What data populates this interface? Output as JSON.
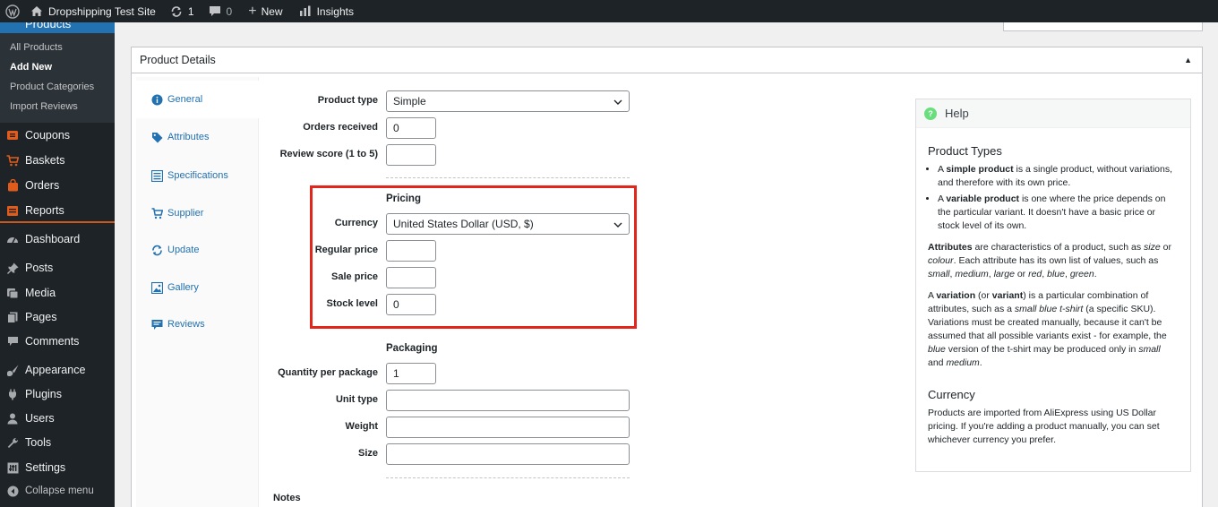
{
  "adminbar": {
    "site_name": "Dropshipping Test Site",
    "updates_count": "1",
    "comments_count": "0",
    "new_label": "New",
    "insights_label": "Insights"
  },
  "sidebar": {
    "active_section": "Products",
    "submenu": [
      "All Products",
      "Add New",
      "Product Categories",
      "Import Reviews"
    ],
    "items": [
      "Coupons",
      "Baskets",
      "Orders",
      "Reports",
      "Dashboard",
      "Posts",
      "Media",
      "Pages",
      "Comments",
      "Appearance",
      "Plugins",
      "Users",
      "Tools",
      "Settings",
      "Collapse menu"
    ]
  },
  "panel": {
    "title": "Product Details"
  },
  "tabs": [
    "General",
    "Attributes",
    "Specifications",
    "Supplier",
    "Update",
    "Gallery",
    "Reviews"
  ],
  "form": {
    "product_type_label": "Product type",
    "product_type_value": "Simple",
    "orders_received_label": "Orders received",
    "orders_received_value": "0",
    "review_score_label": "Review score (1 to 5)",
    "review_score_value": "",
    "pricing_title": "Pricing",
    "currency_label": "Currency",
    "currency_value": "United States Dollar (USD, $)",
    "regular_price_label": "Regular price",
    "regular_price_value": "",
    "sale_price_label": "Sale price",
    "sale_price_value": "",
    "stock_level_label": "Stock level",
    "stock_level_value": "0",
    "packaging_title": "Packaging",
    "qty_per_package_label": "Quantity per package",
    "qty_per_package_value": "1",
    "unit_type_label": "Unit type",
    "unit_type_value": "",
    "weight_label": "Weight",
    "weight_value": "",
    "size_label": "Size",
    "size_value": "",
    "notes_label": "Notes"
  },
  "help": {
    "title": "Help",
    "product_types_heading": "Product Types",
    "simple_bold": "simple product",
    "simple_text": " is a single product, without variations, and therefore with its own price.",
    "variable_bold": "variable product",
    "variable_text": " is one where the price depends on the particular variant. It doesn't have a basic price or stock level of its own.",
    "a_prefix": "A ",
    "attributes_bold": "Attributes",
    "attributes_text_1": " are characteristics of a product, such as ",
    "attr_size": "size",
    "attr_or": " or ",
    "attr_colour": "colour",
    "attributes_text_2": ". Each attribute has its own list of values, such as ",
    "attr_small": "small",
    "comma": ", ",
    "attr_medium": "medium",
    "attr_large": "large",
    "attr_or2": " or ",
    "attr_red": "red",
    "attr_blue": "blue",
    "attr_green": "green",
    "period": ".",
    "variation_prefix": "A ",
    "variation_bold": "variation",
    "variation_paren_open": " (or ",
    "variant_bold": "variant",
    "variation_text_1": ") is a particular combination of attributes, such as a ",
    "var_small_blue": "small blue t-shirt",
    "variation_text_2": " (a specific SKU). Variations must be created manually, because it can't be assumed that all possible variants exist - for example, the ",
    "var_blue": "blue",
    "variation_text_3": " version of the t-shirt may be produced only in ",
    "var_small": "small",
    "var_and": " and ",
    "var_medium": "medium",
    "currency_heading": "Currency",
    "currency_text": "Products are imported from AliExpress using US Dollar pricing. If you're adding a product manually, you can set whichever currency you prefer."
  },
  "colors": {
    "admin_dark": "#1d2327",
    "accent_blue": "#2271b1",
    "highlight_red": "#e3261c",
    "woo_orange": "#e05c1d"
  }
}
